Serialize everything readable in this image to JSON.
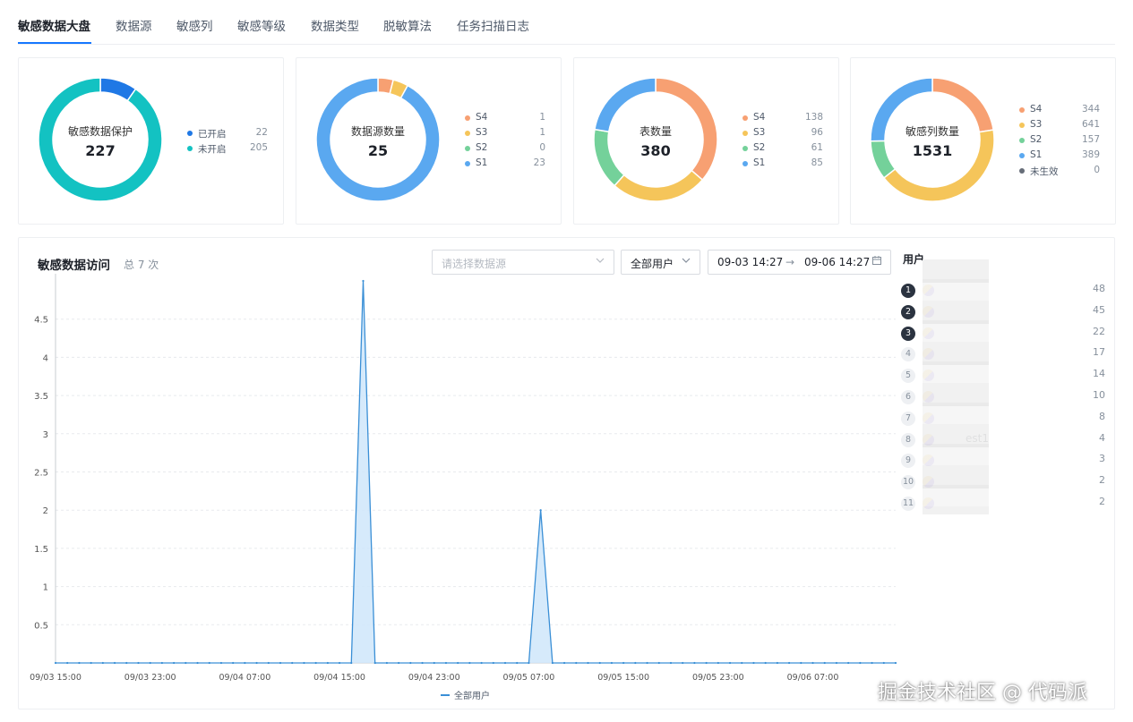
{
  "tabs": [
    {
      "label": "敏感数据大盘",
      "active": true
    },
    {
      "label": "数据源"
    },
    {
      "label": "敏感列"
    },
    {
      "label": "敏感等级"
    },
    {
      "label": "数据类型"
    },
    {
      "label": "脱敏算法"
    },
    {
      "label": "任务扫描日志"
    }
  ],
  "cards": [
    {
      "title": "敏感数据保护",
      "value": "227",
      "legend": [
        {
          "name": "已开启",
          "value": "22",
          "color": "#1f78e5"
        },
        {
          "name": "未开启",
          "value": "205",
          "color": "#13c2c2"
        }
      ]
    },
    {
      "title": "数据源数量",
      "value": "25",
      "legend": [
        {
          "name": "S4",
          "value": "1",
          "color": "#f7a072"
        },
        {
          "name": "S3",
          "value": "1",
          "color": "#f5c55a"
        },
        {
          "name": "S2",
          "value": "0",
          "color": "#74d19a"
        },
        {
          "name": "S1",
          "value": "23",
          "color": "#5aa8f0"
        }
      ]
    },
    {
      "title": "表数量",
      "value": "380",
      "legend": [
        {
          "name": "S4",
          "value": "138",
          "color": "#f7a072"
        },
        {
          "name": "S3",
          "value": "96",
          "color": "#f5c55a"
        },
        {
          "name": "S2",
          "value": "61",
          "color": "#74d19a"
        },
        {
          "name": "S1",
          "value": "85",
          "color": "#5aa8f0"
        }
      ]
    },
    {
      "title": "敏感列数量",
      "value": "1531",
      "legend": [
        {
          "name": "S4",
          "value": "344",
          "color": "#f7a072"
        },
        {
          "name": "S3",
          "value": "641",
          "color": "#f5c55a"
        },
        {
          "name": "S2",
          "value": "157",
          "color": "#74d19a"
        },
        {
          "name": "S1",
          "value": "389",
          "color": "#5aa8f0"
        },
        {
          "name": "未生效",
          "value": "0",
          "color": "#666d78"
        }
      ]
    }
  ],
  "access": {
    "title": "敏感数据访问",
    "total": "总 7 次",
    "datasource_placeholder": "请选择数据源",
    "user_select": "全部用户",
    "date_start": "09-03 14:27",
    "date_end": "09-06 14:27",
    "date_sep": "→"
  },
  "users": {
    "header": "用户",
    "rows": [
      {
        "rank": "1",
        "name": "",
        "count": "48"
      },
      {
        "rank": "2",
        "name": "",
        "count": "45"
      },
      {
        "rank": "3",
        "name": "",
        "count": "22"
      },
      {
        "rank": "4",
        "name": "",
        "count": "17"
      },
      {
        "rank": "5",
        "name": "",
        "count": "14"
      },
      {
        "rank": "6",
        "name": "",
        "count": "10"
      },
      {
        "rank": "7",
        "name": "",
        "count": "8"
      },
      {
        "rank": "8",
        "name": "est1",
        "count": "4"
      },
      {
        "rank": "9",
        "name": "",
        "count": "3"
      },
      {
        "rank": "10",
        "name": "",
        "count": "2"
      },
      {
        "rank": "11",
        "name": "",
        "count": "2"
      }
    ]
  },
  "watermark": "掘金技术社区 @ 代码派",
  "chart_data": [
    {
      "type": "pie",
      "title": "敏感数据保护",
      "categories": [
        "已开启",
        "未开启"
      ],
      "values": [
        22,
        205
      ],
      "colors": [
        "#1f78e5",
        "#13c2c2"
      ]
    },
    {
      "type": "pie",
      "title": "数据源数量",
      "categories": [
        "S4",
        "S3",
        "S2",
        "S1"
      ],
      "values": [
        1,
        1,
        0,
        23
      ],
      "colors": [
        "#f7a072",
        "#f5c55a",
        "#74d19a",
        "#5aa8f0"
      ]
    },
    {
      "type": "pie",
      "title": "表数量",
      "categories": [
        "S4",
        "S3",
        "S2",
        "S1"
      ],
      "values": [
        138,
        96,
        61,
        85
      ],
      "colors": [
        "#f7a072",
        "#f5c55a",
        "#74d19a",
        "#5aa8f0"
      ]
    },
    {
      "type": "pie",
      "title": "敏感列数量",
      "categories": [
        "S4",
        "S3",
        "S2",
        "S1",
        "未生效"
      ],
      "values": [
        344,
        641,
        157,
        389,
        0
      ],
      "colors": [
        "#f7a072",
        "#f5c55a",
        "#74d19a",
        "#5aa8f0",
        "#666d78"
      ]
    },
    {
      "type": "area",
      "title": "敏感数据访问",
      "xlabel": "",
      "ylabel": "",
      "ylim": [
        0,
        5
      ],
      "yticks": [
        "0.5",
        "1",
        "1.5",
        "2",
        "2.5",
        "3",
        "3.5",
        "4",
        "4.5"
      ],
      "xticks": [
        "09/03 15:00",
        "09/03 23:00",
        "09/04 07:00",
        "09/04 15:00",
        "09/04 23:00",
        "09/05 07:00",
        "09/05 15:00",
        "09/05 23:00",
        "09/06 07:00"
      ],
      "x_start": "09/03 15:00",
      "x_end": "09/06 14:00",
      "x_step_hours": 1,
      "grid": true,
      "legend": "bottom",
      "series": [
        {
          "name": "全部用户",
          "color": "#3a8fd6",
          "points": [
            {
              "x": "09/04 17:00",
              "y": 5
            },
            {
              "x": "09/05 08:00",
              "y": 2
            }
          ]
        }
      ]
    }
  ]
}
